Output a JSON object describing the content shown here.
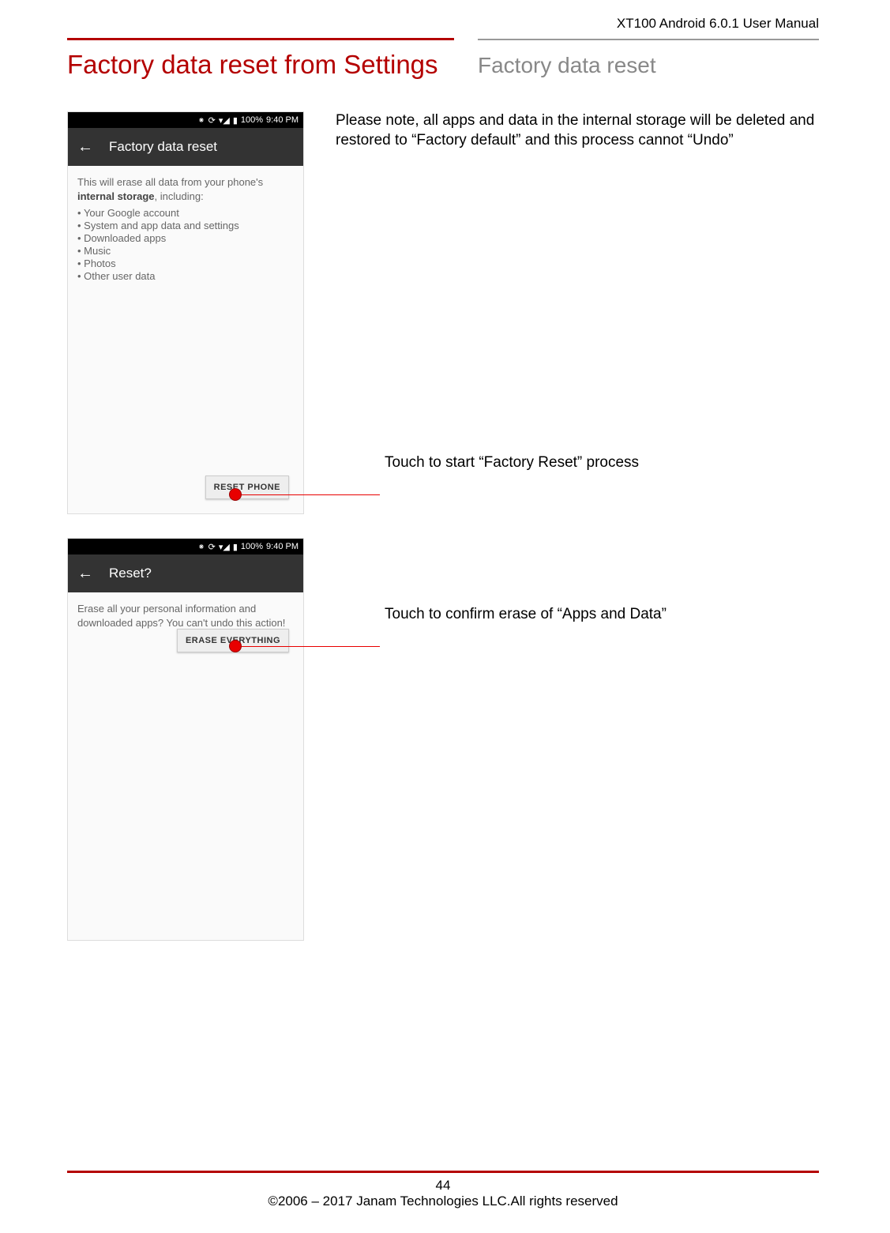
{
  "header": {
    "right": "XT100 Android 6.0.1 User Manual"
  },
  "titles": {
    "left": "Factory data reset from Settings",
    "right": "Factory data reset"
  },
  "note": "Please note, all apps and data in the internal storage will be deleted and restored to “Factory default” and this process cannot “Undo”",
  "phone1": {
    "status_pct": "100%",
    "status_time": "9:40 PM",
    "appbar_title": "Factory data reset",
    "body_prefix": "This will erase all data from your phone's ",
    "body_bold": "internal storage",
    "body_suffix": ", including:",
    "bullets": [
      "Your Google account",
      "System and app data and settings",
      "Downloaded apps",
      "Music",
      "Photos",
      "Other user data"
    ],
    "button": "RESET PHONE"
  },
  "phone2": {
    "status_pct": "100%",
    "status_time": "9:40 PM",
    "appbar_title": "Reset?",
    "body": "Erase all your personal information and downloaded apps? You can't undo this action!",
    "button": "ERASE EVERYTHING"
  },
  "callouts": {
    "c1": "Touch to start “Factory Reset” process",
    "c2": "Touch to confirm erase of “Apps and Data”"
  },
  "footer": {
    "page": "44",
    "copyright": "©2006 – 2017 Janam Technologies LLC.All rights reserved"
  }
}
